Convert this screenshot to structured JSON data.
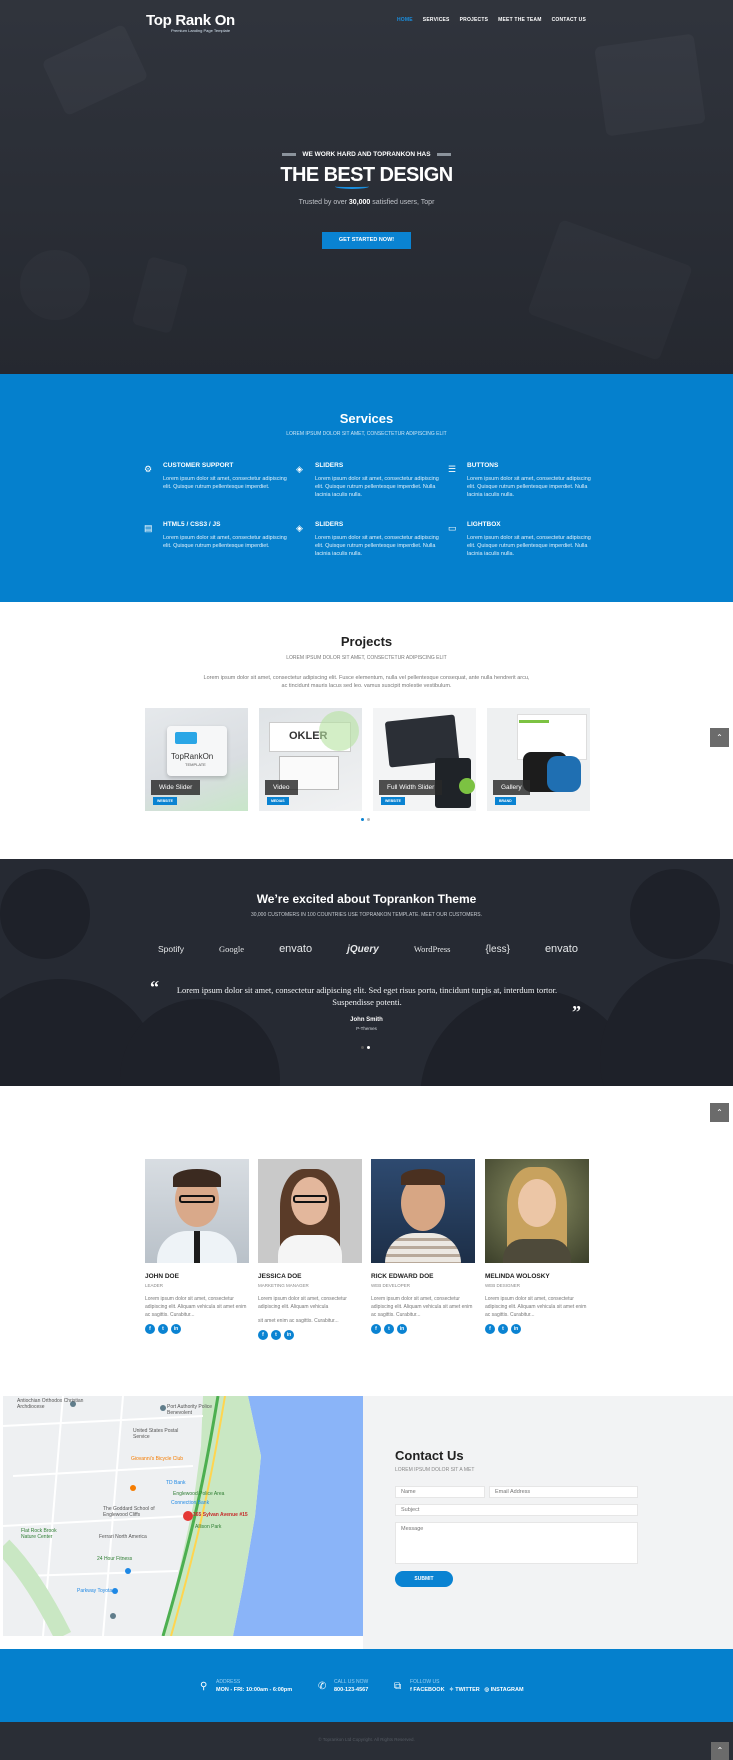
{
  "header": {
    "logo_brand": "Top Rank On",
    "logo_tagline": "Premium Landing Page Template",
    "nav": [
      "HOME",
      "SERVICES",
      "PROJECTS",
      "MEET THE TEAM",
      "CONTACT US"
    ]
  },
  "hero": {
    "kicker": "WE WORK HARD AND TOPRANKON HAS",
    "title": "THE BEST DESIGN",
    "subtitle_pre": "Trusted by over ",
    "subtitle_num": "30,000",
    "subtitle_post": " satisfied users, Topr",
    "cta": "GET STARTED NOW!"
  },
  "services": {
    "title": "Services",
    "subtitle": "LOREM IPSUM DOLOR SIT AMET, CONSECTETUR ADIPISCING ELIT",
    "items": [
      {
        "icon": "support-icon",
        "title": "CUSTOMER SUPPORT",
        "text": "Lorem ipsum dolor sit amet, consectetur adipiscing elit. Quisque rutrum pellentesque imperdiet."
      },
      {
        "icon": "layers-icon",
        "title": "SLIDERS",
        "text": "Lorem ipsum dolor sit amet, consectetur adipiscing elit. Quisque rutrum pellentesque imperdiet. Nulla lacinia iaculis nulla."
      },
      {
        "icon": "menu-icon",
        "title": "BUTTONS",
        "text": "Lorem ipsum dolor sit amet, consectetur adipiscing elit. Quisque rutrum pellentesque imperdiet. Nulla lacinia iaculis nulla."
      },
      {
        "icon": "file-icon",
        "title": "HTML5 / CSS3 / JS",
        "text": "Lorem ipsum dolor sit amet, consectetur adipiscing elit. Quisque rutrum pellentesque imperdiet."
      },
      {
        "icon": "layers-icon",
        "title": "SLIDERS",
        "text": "Lorem ipsum dolor sit amet, consectetur adipiscing elit. Quisque rutrum pellentesque imperdiet. Nulla lacinia iaculis nulla."
      },
      {
        "icon": "monitor-icon",
        "title": "LIGHTBOX",
        "text": "Lorem ipsum dolor sit amet, consectetur adipiscing elit. Quisque rutrum pellentesque imperdiet. Nulla lacinia iaculis nulla."
      }
    ]
  },
  "projects": {
    "title": "Projects",
    "subtitle": "LOREM IPSUM DOLOR SIT AMET, CONSECTETUR ADIPISCING ELIT",
    "intro": "Lorem ipsum dolor sit amet, consectetur adipiscing elit. Fusce elementum, nulla vel pellentesque consequat, ante nulla hendrerit arcu, ac tincidunt mauris lacus sed leo. vamus suscipit molestie vestibulum.",
    "cards": [
      {
        "title": "Wide Slider",
        "badge": "WEBSITE",
        "art_text": "TopRankOn",
        "art_sub": "TEMPLATE"
      },
      {
        "title": "Video",
        "badge": "MEDIAS",
        "art_text": "OKLER",
        "art_sub": ""
      },
      {
        "title": "Full Width Slider",
        "badge": "WEBSITE",
        "art_text": "",
        "art_sub": ""
      },
      {
        "title": "Gallery",
        "badge": "BRAND",
        "art_text": "",
        "art_sub": ""
      }
    ]
  },
  "testimonial": {
    "title": "We’re excited about Toprankon Theme",
    "subtitle": "30,000 CUSTOMERS IN 100 COUNTRIES USE TOPRANKON TEMPLATE. MEET OUR CUSTOMERS.",
    "logos": [
      "Spotify",
      "Google",
      "envato",
      "jQuery",
      "WordPress",
      "{less}",
      "envato"
    ],
    "quote": "Lorem ipsum dolor sit amet, consectetur adipiscing elit. Sed eget risus porta, tincidunt turpis at, interdum tortor. Suspendisse potenti.",
    "author": "John Smith",
    "author_role": "P-Themes"
  },
  "team": [
    {
      "name": "JOHN DOE",
      "role": "LEADER",
      "bio": "Lorem ipsum dolor sit amet, consectetur adipiscing elit. Aliquam vehicula sit amet enim ac sagittis. Curabitur..."
    },
    {
      "name": "JESSICA DOE",
      "role": "MARKETING MANAGER",
      "bio": "Lorem ipsum dolor sit amet, consectetur adipiscing elit. Aliquam vehicula",
      "bio2": "sit amet enim ac sagittis. Curabitur..."
    },
    {
      "name": "RICK EDWARD DOE",
      "role": "WEB DEVELOPER",
      "bio": "Lorem ipsum dolor sit amet, consectetur adipiscing elit. Aliquam vehicula sit amet enim ac sagittis. Curabitur..."
    },
    {
      "name": "MELINDA WOLOSKY",
      "role": "WEB DESIGNER",
      "bio": "Lorem ipsum dolor sit amet, consectetur adipiscing elit. Aliquam vehicula sit amet enim ac sagittis. Curabitur..."
    }
  ],
  "map": {
    "labels": [
      "Antiochian Orthodox Christian Archdiocese",
      "Port Authority Police Benevolent",
      "United States Postal Service",
      "Giovanni's Bicycle Club",
      "TD Bank",
      "Englewood Police Area",
      "The Goddard School of Englewood Cliffs",
      "Flat Rock Brook Nature Center",
      "Ferrari North America",
      "24 Hour Fitness",
      "Parkway Toyota",
      "Connection Bank",
      "Allison Park",
      "365 Sylvan Avenue #15"
    ]
  },
  "contact": {
    "title": "Contact Us",
    "subtitle": "LOREM IPSUM DOLOR SIT A MET",
    "name_ph": "Name",
    "email_ph": "Email Address",
    "subject_ph": "Subject",
    "message_ph": "Message",
    "submit": "SUBMIT"
  },
  "footer": {
    "address_label": "ADDRESS",
    "address_value": "MON - FRI: 10:00am - 6:00pm",
    "call_label": "CALL US NOW",
    "call_value": "800-123-4567",
    "follow_label": "FOLLOW US",
    "facebook": "FACEBOOK",
    "twitter": "TWITTER",
    "instagram": "INSTAGRAM",
    "copyright": "© Toprankon Ltd Copyright. All Rights Reserved."
  },
  "colors": {
    "accent": "#0580cd",
    "dark": "#262a33"
  }
}
